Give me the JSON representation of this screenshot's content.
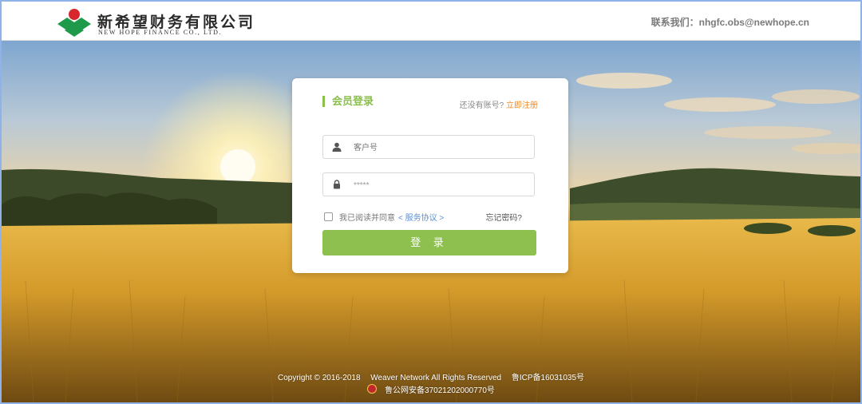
{
  "header": {
    "brand_cn": "新希望财务有限公司",
    "brand_en": "NEW HOPE FINANCE CO., LTD.",
    "contact": "联系我们：nhgfc.obs@newhope.cn"
  },
  "login": {
    "title": "会员登录",
    "no_account": "还没有账号?",
    "register": "立即注册",
    "username_placeholder": "客户号",
    "password_value": "*****",
    "agree_text": "我已阅读并同意",
    "service_link": "< 服务协议 >",
    "forgot": "忘记密码?",
    "submit": "登 录"
  },
  "footer": {
    "copyright": "Copyright © 2016-2018",
    "rights": "Weaver Network All Rights Reserved",
    "icp": "鲁ICP备16031035号",
    "police": "鲁公网安备37021202000770号"
  },
  "colors": {
    "accent_green": "#8dc04f",
    "link_orange": "#f08b2a",
    "link_blue": "#5b8fd9"
  }
}
